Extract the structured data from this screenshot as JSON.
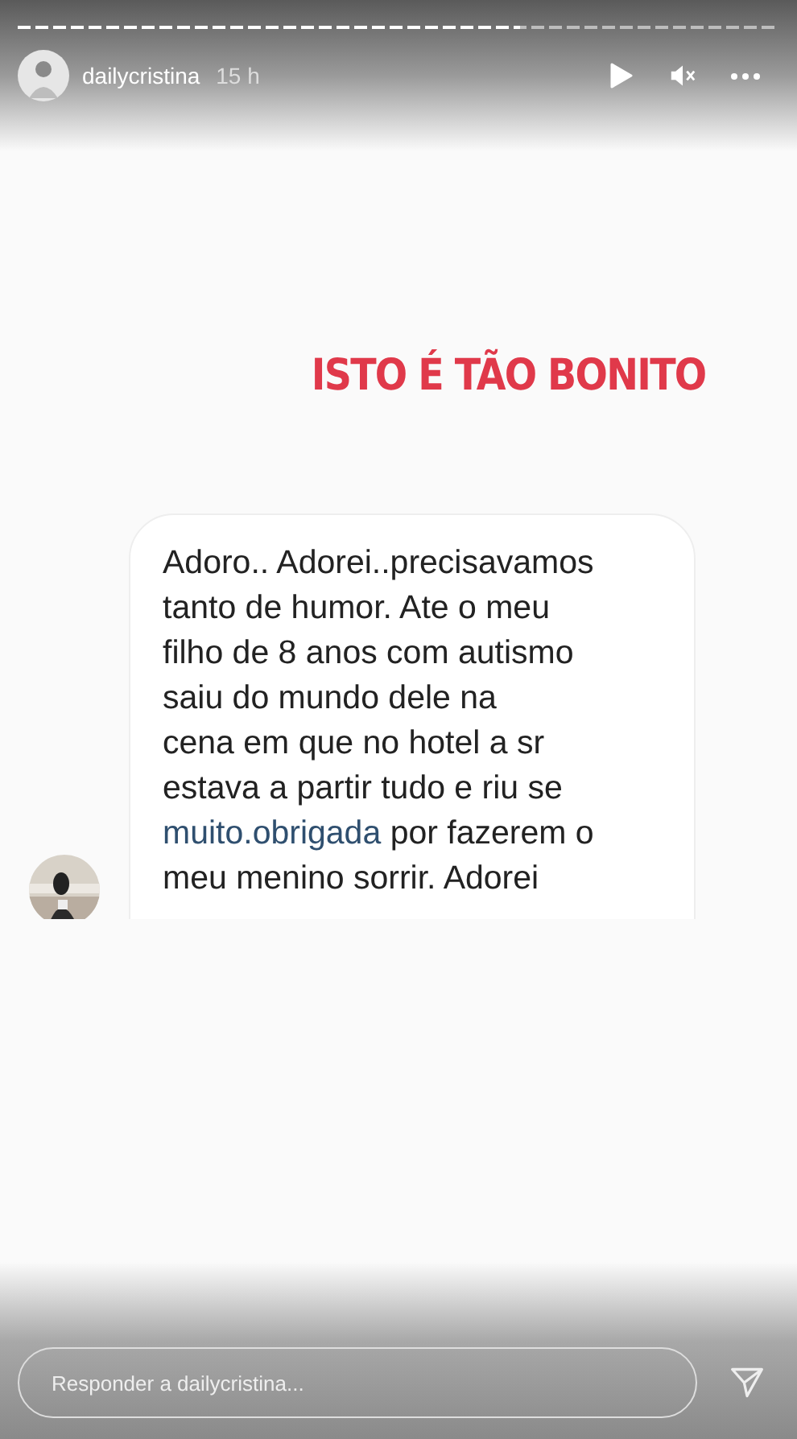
{
  "story_progress": {
    "level": 0.66
  },
  "header": {
    "username": "dailycristina",
    "time": "15 h"
  },
  "caption": "ISTO É TÃO BONITO",
  "message": {
    "before": "Adoro.. Adorei..precisavamos\ntanto de humor. Ate o meu\nfilho de 8 anos com autismo\nsaiu do mundo dele na\ncena em que no hotel a sr\nestava a partir tudo e riu se\n",
    "link": "muito.obrigada",
    "after": " por fazerem o\nmeu menino sorrir. Adorei"
  },
  "reply": {
    "placeholder": "Responder a dailycristina..."
  }
}
